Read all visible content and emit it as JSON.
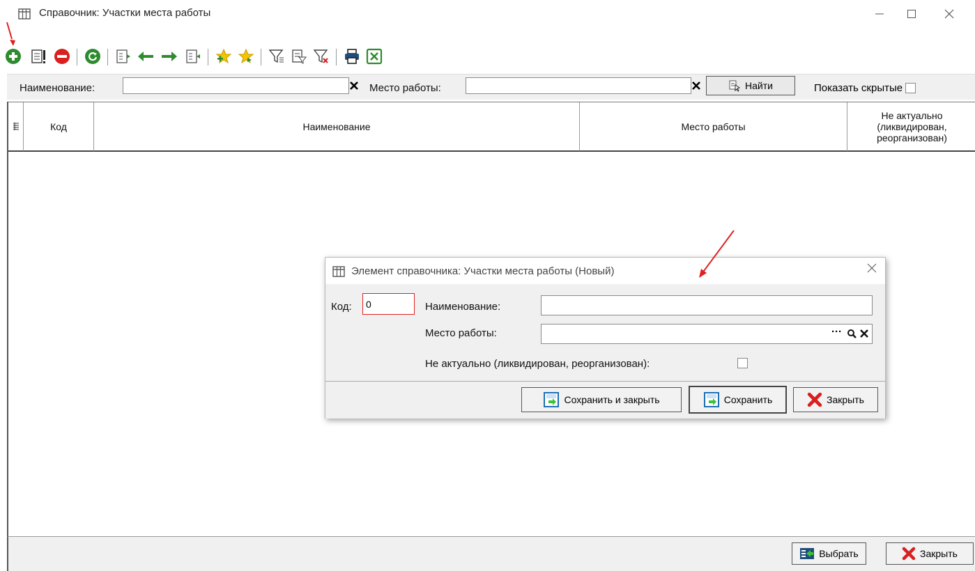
{
  "window": {
    "title": "Справочник: Участки места работы"
  },
  "filters": {
    "name_label": "Наименование:",
    "name_value": "",
    "workplace_label": "Место работы:",
    "workplace_value": "",
    "find_button": "Найти",
    "show_hidden_label": "Показать скрытые"
  },
  "grid": {
    "columns": [
      "Код",
      "Наименование",
      "Место работы",
      "Не актуально (ликвидирован, реорганизован)"
    ],
    "column_lines": [
      "Не актуально",
      "(ликвидирован,",
      "реорганизован)"
    ],
    "rows": []
  },
  "footer": {
    "select_button": "Выбрать",
    "close_button": "Закрыть"
  },
  "dialog": {
    "title": "Элемент справочника: Участки места работы (Новый)",
    "code_label": "Код:",
    "code_value": "0",
    "name_label": "Наименование:",
    "name_value": "",
    "workplace_label": "Место работы:",
    "workplace_value": "",
    "ellipsis": "···",
    "inactive_label": "Не актуально (ликвидирован, реорганизован):",
    "save_close_button": "Сохранить и закрыть",
    "save_button": "Сохранить",
    "close_button": "Закрыть"
  },
  "colors": {
    "annotation_arrow": "#e02020",
    "code_border": "#e02020",
    "accent_green": "#2e8b2e",
    "close_red": "#d92020"
  },
  "icons": [
    "table-icon",
    "add-icon",
    "edit-icon",
    "delete-icon",
    "refresh-icon",
    "move-left-icon",
    "move-right-icon",
    "favorite-add-icon",
    "favorite-icon",
    "filter-icon",
    "filter-edit-icon",
    "filter-clear-icon",
    "print-icon",
    "excel-icon",
    "find-icon",
    "save-icon",
    "close-icon",
    "select-icon"
  ]
}
